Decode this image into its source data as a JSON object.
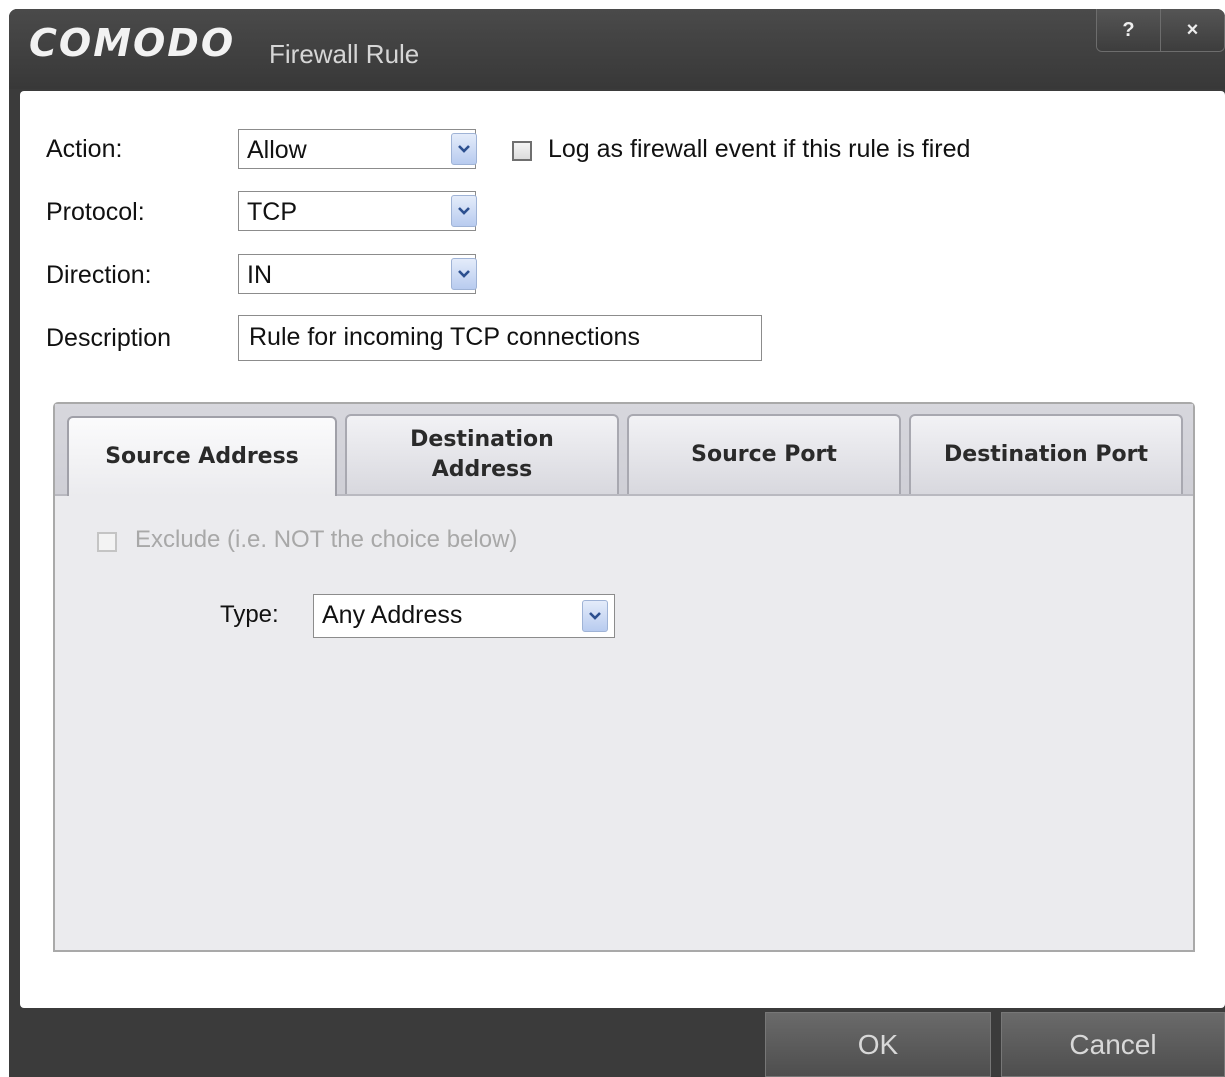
{
  "window": {
    "brand": "COMODO",
    "title": "Firewall Rule",
    "help_button": "?",
    "close_button": "×"
  },
  "form": {
    "action_label": "Action:",
    "action_value": "Allow",
    "log_label": "Log as firewall event if this rule is fired",
    "log_checked": false,
    "protocol_label": "Protocol:",
    "protocol_value": "TCP",
    "direction_label": "Direction:",
    "direction_value": "IN",
    "description_label": "Description",
    "description_value": "Rule for incoming TCP connections"
  },
  "tabs": [
    {
      "label": "Source Address",
      "active": true
    },
    {
      "label": "Destination Address",
      "line1": "Destination",
      "line2": "Address",
      "active": false
    },
    {
      "label": "Source Port",
      "active": false
    },
    {
      "label": "Destination Port",
      "active": false
    }
  ],
  "panel": {
    "exclude_label": "Exclude (i.e. NOT the choice below)",
    "exclude_checked": false,
    "exclude_disabled": true,
    "type_label": "Type:",
    "type_value": "Any Address"
  },
  "buttons": {
    "ok": "OK",
    "cancel": "Cancel"
  },
  "colors": {
    "titlebar": "#3b3b3b",
    "panel_bg": "#ebebee",
    "dropdown_arrow": "#b8cbef"
  }
}
